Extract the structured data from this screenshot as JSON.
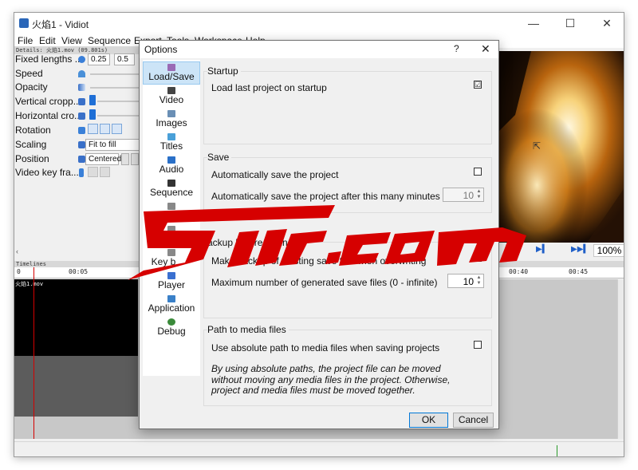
{
  "window": {
    "title": "火焰1 - Vidiot",
    "menu": [
      "File",
      "Edit",
      "View",
      "Sequence",
      "Export",
      "Tools",
      "Workspace",
      "Help"
    ]
  },
  "details": {
    "header": "Details: 火焰1.mov (09.801s)",
    "properties": [
      {
        "label": "Fixed lengths ...",
        "value": "0.25",
        "value2": "0.5"
      },
      {
        "label": "Speed"
      },
      {
        "label": "Opacity"
      },
      {
        "label": "Vertical cropp..."
      },
      {
        "label": "Horizontal cro..."
      },
      {
        "label": "Rotation"
      },
      {
        "label": "Scaling",
        "value": "Fit to fill"
      },
      {
        "label": "Position",
        "value": "Centered"
      },
      {
        "label": "Video key fra..."
      }
    ]
  },
  "preview": {
    "zoom": "100%"
  },
  "timeline": {
    "header": "Timelines",
    "ruler_labels": [
      "0",
      "00:05",
      "00:40",
      "00:45"
    ],
    "clip_name": "火焰1.mov"
  },
  "dialog": {
    "title": "Options",
    "help": "?",
    "close": "✕",
    "sidebar": [
      {
        "label": "Load/Save",
        "icon": "load-save-icon",
        "color": "#9a6ab5"
      },
      {
        "label": "Video",
        "icon": "video-icon",
        "color": "#444444"
      },
      {
        "label": "Images",
        "icon": "images-icon",
        "color": "#6a8fb5"
      },
      {
        "label": "Titles",
        "icon": "titles-icon",
        "color": "#4aa0d8"
      },
      {
        "label": "Audio",
        "icon": "audio-icon",
        "color": "#2a70c8"
      },
      {
        "label": "Sequence",
        "icon": "sequence-icon",
        "color": "#333333"
      },
      {
        "label": "e",
        "icon": "timeline-icon",
        "color": "#888888"
      },
      {
        "label": "Expor",
        "icon": "export-icon",
        "color": "#888888"
      },
      {
        "label": "Key b",
        "icon": "keyboard-icon",
        "color": "#888888"
      },
      {
        "label": "Player",
        "icon": "player-icon",
        "color": "#3a70d0"
      },
      {
        "label": "Application",
        "icon": "application-icon",
        "color": "#3a80c8"
      },
      {
        "label": "Debug",
        "icon": "debug-icon",
        "color": "#3a8a3a"
      }
    ],
    "startup": {
      "title": "Startup",
      "load_last": "Load last project on startup",
      "load_last_checked": "☑"
    },
    "save": {
      "title": "Save",
      "auto_save": "Automatically save the project",
      "auto_save_minutes": "Automatically save the project after this many minutes",
      "minutes_value": "10"
    },
    "backup": {
      "title": "ackup before savin",
      "make_backup": "Make backup of existing save file when overwriting",
      "make_backup_checked": "☑",
      "max_files": "Maximum number of generated save files (0 - infinite)",
      "max_files_value": "10"
    },
    "media": {
      "title": "Path to media files",
      "absolute": "Use absolute path to media files when saving projects",
      "note": "By using absolute paths, the project file can be moved without moving any media files in the project. Otherwise, project and media files must be moved together."
    },
    "ok": "OK",
    "cancel": "Cancel"
  },
  "colors": {
    "watermark": "#d60000",
    "selection": "#cce4f7",
    "accent": "#0078d7"
  }
}
